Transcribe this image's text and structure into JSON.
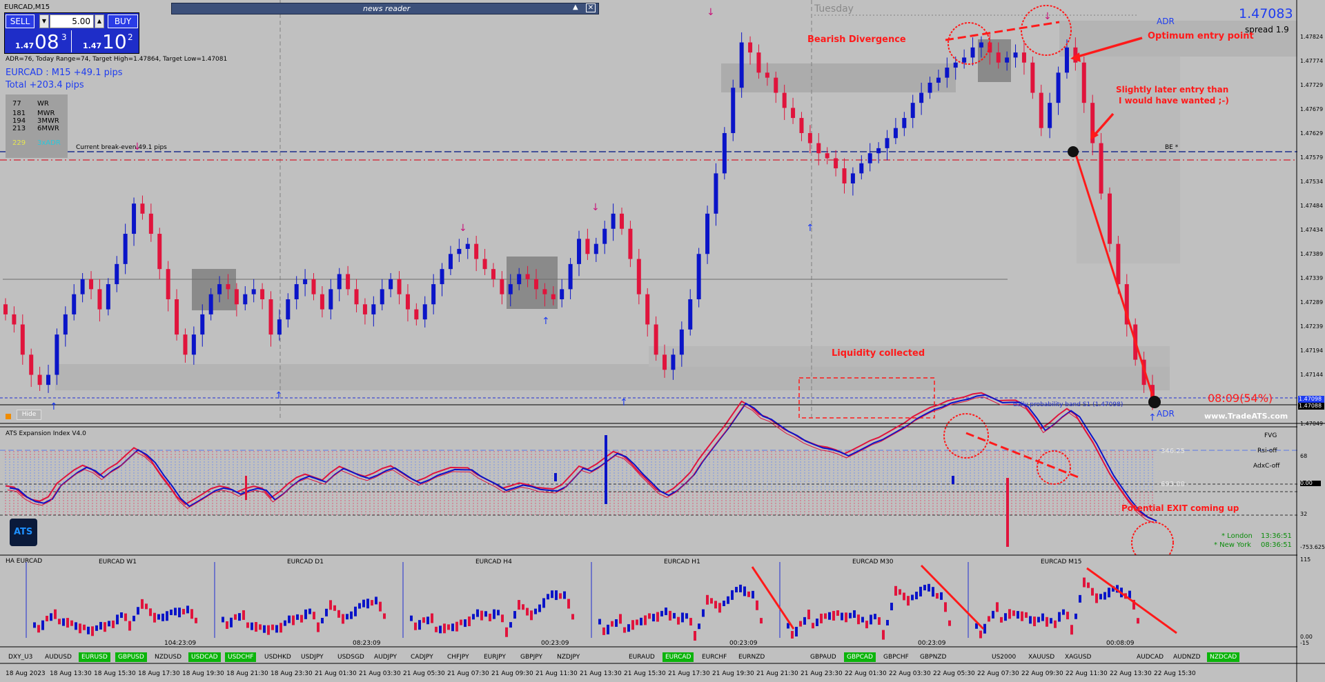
{
  "window": {
    "title": "EURCAD,M15"
  },
  "trade_panel": {
    "sell_label": "SELL",
    "buy_label": "BUY",
    "lot_value": "5.00",
    "dropdown_glyph": "▼",
    "up_glyph": "▲",
    "sell_price_prefix": "1.47",
    "sell_price_big": "08",
    "sell_price_sup": "3",
    "buy_price_prefix": "1.47",
    "buy_price_big": "10",
    "buy_price_sup": "2"
  },
  "info": {
    "adr_line": "ADR=76, Today Range=74, Target High=1.47864, Target Low=1.47081",
    "pair_pips": "EURCAD : M15 +49.1 pips",
    "total_pips": "Total +203.4 pips"
  },
  "wr_table": {
    "rows": [
      {
        "n": "77",
        "label": "WR"
      },
      {
        "n": "181",
        "label": "MWR"
      },
      {
        "n": "194",
        "label": "3MWR"
      },
      {
        "n": "213",
        "label": "6MWR"
      },
      {
        "n": "229",
        "label": "3xADR"
      }
    ]
  },
  "news": {
    "title": "news reader",
    "collapse_glyph": "▲",
    "close_glyph": "✕"
  },
  "header_right": {
    "price": "1.47083",
    "spread": "spread 1.9",
    "day_label": "Tuesday",
    "adr_top": "ADR",
    "adr_bottom": "ADR"
  },
  "break_even": {
    "text": "Current break-even  49.1 pips",
    "marker": "BE *"
  },
  "annotations": {
    "bearish_divergence": "Bearish Divergence",
    "optimum_entry": "Optimum entry point",
    "later_entry_1": "Slightly later entry than",
    "later_entry_2": "I would have wanted ;-)",
    "liquidity": "Liquidity collected",
    "potential_exit": "Potential EXIT coming up",
    "countdown": "08:09(54%)",
    "website": "www.TradeATS.com",
    "daily_band": "daily probability band S1 (1.47098)"
  },
  "hide_button": {
    "label": "Hide"
  },
  "price_axis": {
    "labels": [
      "1.47824",
      "1.47774",
      "1.47729",
      "1.47679",
      "1.47629",
      "1.47579",
      "1.47534",
      "1.47484",
      "1.47434",
      "1.47389",
      "1.47339",
      "1.47289",
      "1.47239",
      "1.47194",
      "1.47144"
    ],
    "current_box_1": "1.47098",
    "current_box_2": "1.47088",
    "bottom_label": "1.47049"
  },
  "indicator": {
    "title": "ATS Expansion Index V4.0",
    "fvg": "FVG",
    "rsi_off": "Rsi-off",
    "adxc_off": "AdxC-off",
    "level_1": "346.25",
    "level_2": "693.00",
    "axis": [
      "68",
      "0.00",
      "32",
      "-753.625"
    ],
    "logo": "ATS",
    "london": "* London",
    "london_time": "13:36:51",
    "new_york": "* New York",
    "new_york_time": "08:36:51"
  },
  "ha_panel": {
    "title": "HA EURCAD",
    "charts": [
      {
        "label": "EURCAD W1",
        "time": "104:23:09"
      },
      {
        "label": "EURCAD D1",
        "time": "08:23:09"
      },
      {
        "label": "EURCAD H4",
        "time": "00:23:09"
      },
      {
        "label": "EURCAD H1",
        "time": "00:23:09"
      },
      {
        "label": "EURCAD M30",
        "time": "00:23:09"
      },
      {
        "label": "EURCAD M15",
        "time": "00:08:09"
      }
    ],
    "axis_top": "115",
    "axis_zero": "0.00",
    "axis_bottom": "-15"
  },
  "symbols": [
    {
      "label": "DXY_U3",
      "active": false
    },
    {
      "label": "AUDUSD",
      "active": false
    },
    {
      "label": "EURUSD",
      "active": true
    },
    {
      "label": "GBPUSD",
      "active": true
    },
    {
      "label": "NZDUSD",
      "active": false
    },
    {
      "label": "USDCAD",
      "active": true
    },
    {
      "label": "USDCHF",
      "active": true
    },
    {
      "label": "USDHKD",
      "active": false
    },
    {
      "label": "USDJPY",
      "active": false
    },
    {
      "label": "USDSGD",
      "active": false
    },
    {
      "label": "AUDJPY",
      "active": false
    },
    {
      "label": "CADJPY",
      "active": false
    },
    {
      "label": "CHFJPY",
      "active": false
    },
    {
      "label": "EURJPY",
      "active": false
    },
    {
      "label": "GBPJPY",
      "active": false
    },
    {
      "label": "NZDJPY",
      "active": false
    },
    {
      "label": "EURAUD",
      "active": false
    },
    {
      "label": "EURCAD",
      "active": true
    },
    {
      "label": "EURCHF",
      "active": false
    },
    {
      "label": "EURNZD",
      "active": false
    },
    {
      "label": "GBPAUD",
      "active": false
    },
    {
      "label": "GBPCAD",
      "active": true
    },
    {
      "label": "GBPCHF",
      "active": false
    },
    {
      "label": "GBPNZD",
      "active": false
    },
    {
      "label": "US2000",
      "active": false
    },
    {
      "label": "XAUUSD",
      "active": false
    },
    {
      "label": "XAGUSD",
      "active": false
    },
    {
      "label": "AUDCAD",
      "active": false
    },
    {
      "label": "AUDNZD",
      "active": false
    },
    {
      "label": "NZDCAD",
      "active": true
    }
  ],
  "time_axis": [
    "18 Aug 2023",
    "18 Aug 13:30",
    "18 Aug 15:30",
    "18 Aug 17:30",
    "18 Aug 19:30",
    "18 Aug 21:30",
    "18 Aug 23:30",
    "21 Aug 01:30",
    "21 Aug 03:30",
    "21 Aug 05:30",
    "21 Aug 07:30",
    "21 Aug 09:30",
    "21 Aug 11:30",
    "21 Aug 13:30",
    "21 Aug 15:30",
    "21 Aug 17:30",
    "21 Aug 19:30",
    "21 Aug 21:30",
    "21 Aug 23:30",
    "22 Aug 01:30",
    "22 Aug 03:30",
    "22 Aug 05:30",
    "22 Aug 07:30",
    "22 Aug 09:30",
    "22 Aug 11:30",
    "22 Aug 13:30",
    "22 Aug 15:30"
  ],
  "colors": {
    "bull": "#0a14c8",
    "bear": "#e0143c",
    "annotation": "#ff1a1a",
    "active_symbol": "#0bb40b",
    "price_blue": "#1e3cf0"
  },
  "chart_data": {
    "type": "candlestick",
    "symbol": "EURCAD",
    "timeframe": "M15",
    "ylim": [
      1.47049,
      1.4785
    ],
    "current_price": 1.47083,
    "break_even_price": 1.47597,
    "daily_band_s1": 1.47098,
    "closes": [
      1.4726,
      1.4724,
      1.4718,
      1.4714,
      1.4712,
      1.4714,
      1.4722,
      1.4726,
      1.473,
      1.4733,
      1.4731,
      1.4727,
      1.4732,
      1.4736,
      1.4742,
      1.4748,
      1.4746,
      1.4742,
      1.4735,
      1.4729,
      1.4722,
      1.4718,
      1.4722,
      1.4726,
      1.473,
      1.4732,
      1.4731,
      1.4728,
      1.473,
      1.4731,
      1.4729,
      1.4722,
      1.4725,
      1.4729,
      1.4732,
      1.4733,
      1.473,
      1.4727,
      1.4731,
      1.4734,
      1.4731,
      1.4728,
      1.4726,
      1.4728,
      1.4731,
      1.4733,
      1.473,
      1.4727,
      1.4725,
      1.4728,
      1.4732,
      1.4735,
      1.4738,
      1.4739,
      1.474,
      1.4737,
      1.4735,
      1.4733,
      1.473,
      1.4732,
      1.4734,
      1.4733,
      1.4731,
      1.473,
      1.4729,
      1.4731,
      1.4736,
      1.4741,
      1.4738,
      1.474,
      1.4743,
      1.4746,
      1.4743,
      1.4737,
      1.473,
      1.4724,
      1.4718,
      1.4715,
      1.4718,
      1.4723,
      1.4729,
      1.4738,
      1.4746,
      1.4754,
      1.4762,
      1.4771,
      1.478,
      1.4778,
      1.4774,
      1.4773,
      1.477,
      1.4767,
      1.4765,
      1.4762,
      1.476,
      1.4758,
      1.4757,
      1.4755,
      1.4752,
      1.4754,
      1.4756,
      1.4758,
      1.4759,
      1.4761,
      1.4763,
      1.4765,
      1.4768,
      1.477,
      1.4772,
      1.4773,
      1.4775,
      1.4776,
      1.4777,
      1.4779,
      1.478,
      1.4778,
      1.4776,
      1.4777,
      1.4778,
      1.4776,
      1.477,
      1.4763,
      1.4768,
      1.4774,
      1.4779,
      1.4776,
      1.4768,
      1.476,
      1.475,
      1.474,
      1.4732,
      1.4724,
      1.4717,
      1.4712,
      1.4709
    ]
  }
}
